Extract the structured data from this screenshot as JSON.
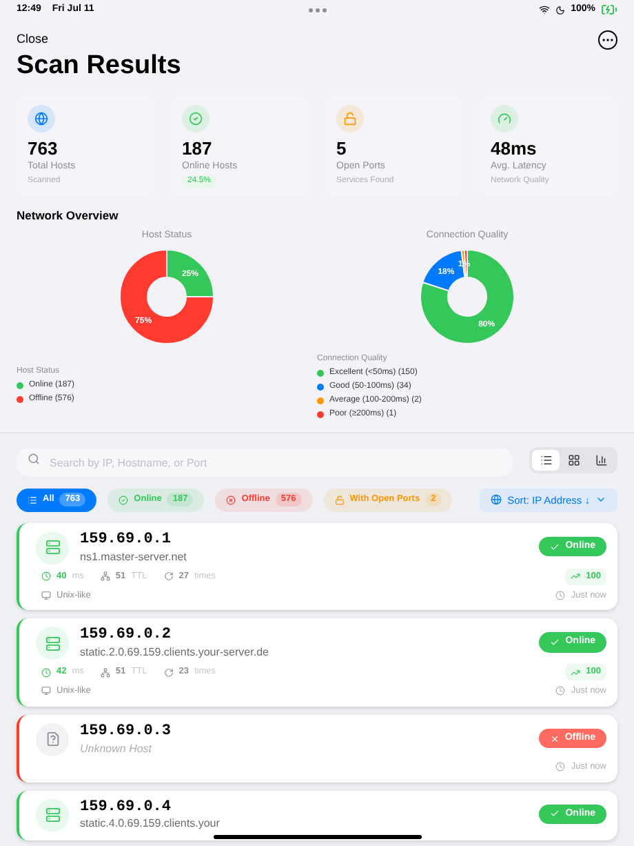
{
  "status_bar": {
    "time": "12:49",
    "date": "Fri Jul 11",
    "battery": "100%"
  },
  "nav": {
    "close": "Close",
    "title": "Scan Results"
  },
  "stats": [
    {
      "value": "763",
      "label": "Total Hosts",
      "sub": "Scanned",
      "kind": "globe",
      "color": "#007aff"
    },
    {
      "value": "187",
      "label": "Online Hosts",
      "sub": "24.5%",
      "kind": "check",
      "color": "#34c759"
    },
    {
      "value": "5",
      "label": "Open Ports",
      "sub": "Services Found",
      "kind": "lock",
      "color": "#ff9500"
    },
    {
      "value": "48ms",
      "label": "Avg. Latency",
      "sub": "Network Quality",
      "kind": "gauge",
      "color": "#34c759"
    }
  ],
  "overview": {
    "title": "Network Overview",
    "charts": [
      {
        "chart_data": {
          "type": "donut",
          "title": "Host Status",
          "series": [
            {
              "values": [
                25,
                75
              ]
            }
          ],
          "colors": [
            "#34c759",
            "#ff3b30"
          ],
          "value_labels": [
            "25%",
            "75%"
          ]
        },
        "legend": {
          "title": "Host Status",
          "items": [
            {
              "label": "Online (187)",
              "color": "#34c759"
            },
            {
              "label": "Offline (576)",
              "color": "#ff3b30"
            }
          ]
        }
      },
      {
        "chart_data": {
          "type": "donut",
          "title": "Connection Quality",
          "series": [
            {
              "values": [
                80,
                18,
                1,
                1
              ]
            }
          ],
          "colors": [
            "#34c759",
            "#007aff",
            "#ff9500",
            "#ff3b30"
          ],
          "value_labels": [
            "80%",
            "18%",
            "1%",
            null
          ]
        },
        "legend": {
          "title": "Connection Quality",
          "items": [
            {
              "label": "Excellent (<50ms) (150)",
              "color": "#34c759"
            },
            {
              "label": "Good (50-100ms) (34)",
              "color": "#007aff"
            },
            {
              "label": "Average (100-200ms) (2)",
              "color": "#ff9500"
            },
            {
              "label": "Poor (≥200ms) (1)",
              "color": "#ff3b30"
            }
          ]
        }
      }
    ]
  },
  "search": {
    "placeholder": "Search by IP, Hostname, or Port"
  },
  "view_modes": [
    {
      "kind": "list",
      "selected": true
    },
    {
      "kind": "grid",
      "selected": false
    },
    {
      "kind": "bars",
      "selected": false
    }
  ],
  "filters": [
    {
      "kind": "all",
      "label": "All",
      "count": "763",
      "selected": true,
      "color": "#007aff"
    },
    {
      "kind": "online",
      "label": "Online",
      "count": "187",
      "selected": false,
      "color": "#34c759"
    },
    {
      "kind": "offline",
      "label": "Offline",
      "count": "576",
      "selected": false,
      "color": "#ff3b30"
    },
    {
      "kind": "ports",
      "label": "With Open Ports",
      "count": "2",
      "selected": false,
      "color": "#ff9500"
    }
  ],
  "sort": {
    "label": "Sort: IP Address ↓"
  },
  "hosts": [
    {
      "kind": "online",
      "ip": "159.69.0.1",
      "hostname": "ns1.master-server.net",
      "status": "Online",
      "latency": "40",
      "latency_unit": "ms",
      "ttl": "51",
      "ttl_unit": "TTL",
      "hops": "27",
      "hops_unit": "times",
      "score": "100",
      "os": "Unix-like",
      "time": "Just now"
    },
    {
      "kind": "online",
      "ip": "159.69.0.2",
      "hostname": "static.2.0.69.159.clients.your-server.de",
      "status": "Online",
      "latency": "42",
      "latency_unit": "ms",
      "ttl": "51",
      "ttl_unit": "TTL",
      "hops": "23",
      "hops_unit": "times",
      "score": "100",
      "os": "Unix-like",
      "time": "Just now"
    },
    {
      "kind": "offline",
      "ip": "159.69.0.3",
      "hostname": "Unknown Host",
      "status": "Offline",
      "time": "Just now"
    },
    {
      "kind": "online",
      "ip": "159.69.0.4",
      "hostname": "static.4.0.69.159.clients.your",
      "status": "Online"
    }
  ]
}
